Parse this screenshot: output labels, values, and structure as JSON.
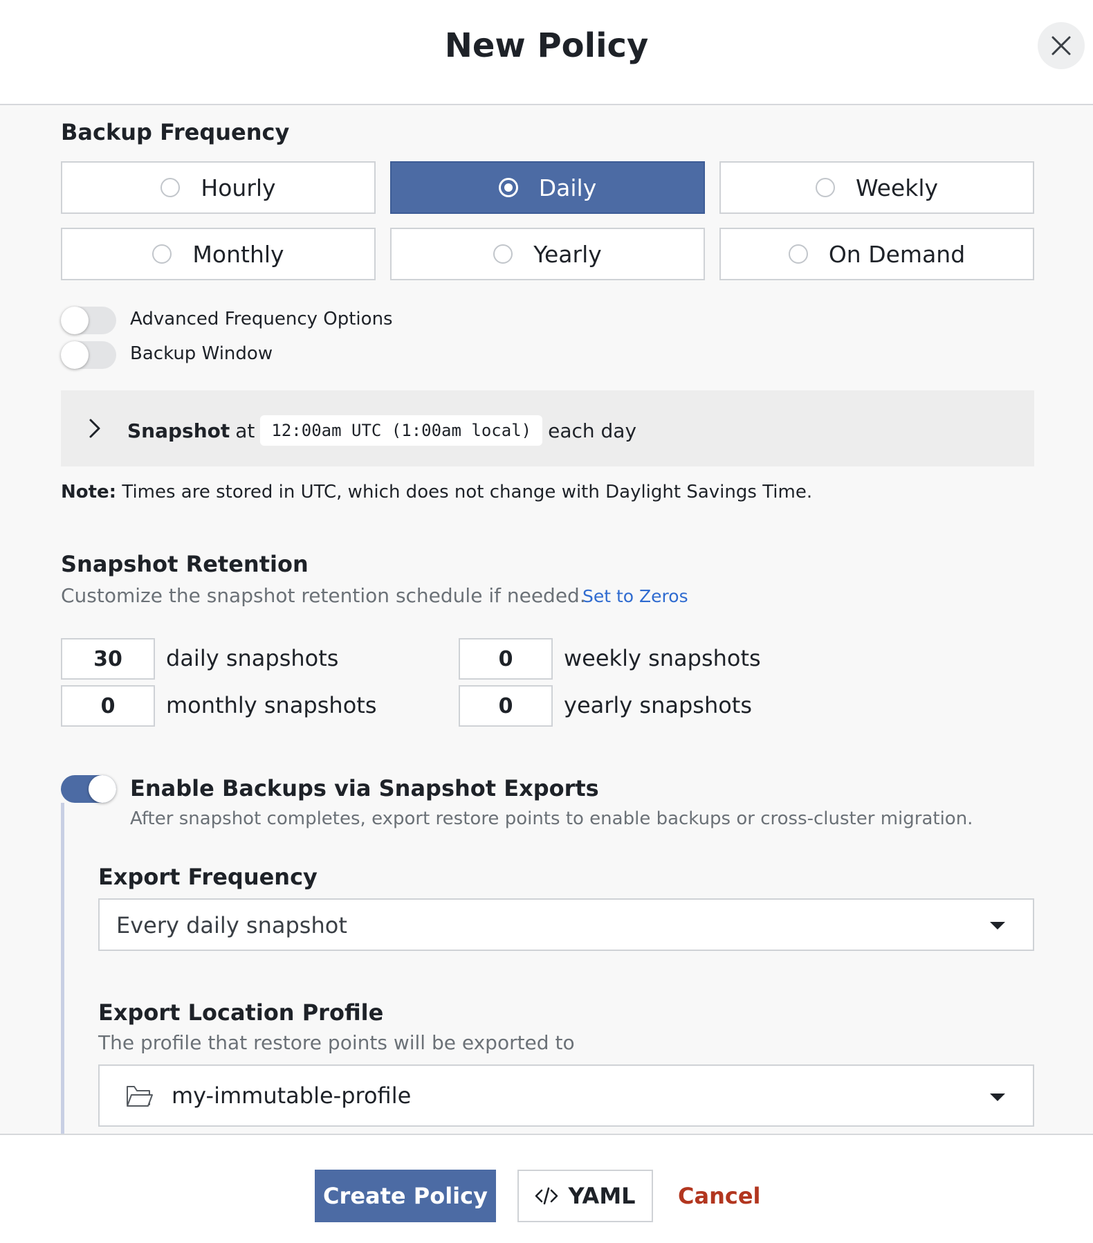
{
  "dialog": {
    "title": "New Policy"
  },
  "backup_frequency": {
    "heading": "Backup Frequency",
    "options": [
      "Hourly",
      "Daily",
      "Weekly",
      "Monthly",
      "Yearly",
      "On Demand"
    ],
    "selected": "Daily"
  },
  "toggles": {
    "advanced_label": "Advanced Frequency Options",
    "advanced_on": false,
    "window_label": "Backup Window",
    "window_on": false
  },
  "snapshot_schedule": {
    "prefix": "Snapshot",
    "at": "at",
    "time": "12:00am UTC (1:00am local)",
    "suffix": "each day"
  },
  "note": {
    "label": "Note:",
    "text": " Times are stored in UTC, which does not change with Daylight Savings Time."
  },
  "retention": {
    "heading": "Snapshot Retention",
    "subtitle": "Customize the snapshot retention schedule if needed.",
    "set_zeros": "Set to Zeros",
    "daily_value": "30",
    "daily_label": "daily snapshots",
    "weekly_value": "0",
    "weekly_label": "weekly snapshots",
    "monthly_value": "0",
    "monthly_label": "monthly snapshots",
    "yearly_value": "0",
    "yearly_label": "yearly snapshots"
  },
  "exports": {
    "enabled": true,
    "title": "Enable Backups via Snapshot Exports",
    "subtitle": "After snapshot completes, export restore points to enable backups or cross-cluster migration.",
    "frequency_heading": "Export Frequency",
    "frequency_value": "Every daily snapshot",
    "location_heading": "Export Location Profile",
    "location_subtitle": "The profile that restore points will be exported to",
    "location_value": "my-immutable-profile"
  },
  "footer": {
    "create": "Create Policy",
    "yaml": "YAML",
    "cancel": "Cancel"
  },
  "colors": {
    "accent": "#4c6ba4",
    "link": "#2f6bd0",
    "danger": "#b2361f"
  }
}
